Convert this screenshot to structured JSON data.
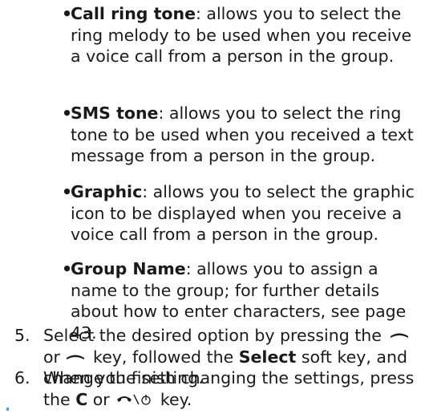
{
  "bullets": [
    {
      "term": "Call ring tone",
      "text": ": allows you to select the ring melody to be used when you receive a voice call from a person in the group."
    },
    {
      "term": "SMS tone",
      "text": ": allows you to select the ring tone to be used when you received a text message from a person in the group."
    },
    {
      "term": "Graphic",
      "text": ": allows you to select the graphic icon to be displayed when you receive a voice call from a person in the group."
    },
    {
      "term": "Group Name",
      "text": ": allows you to assign a name to the group; for further details about how to enter characters, see page 43."
    }
  ],
  "bullet_mark": "•",
  "steps": [
    {
      "number": "5.",
      "part1": "Select the desired option by pressing the",
      "part2": "or",
      "part3": "key, followed the",
      "bold": "Select",
      "part4": "soft key, and change the setting.",
      "icons": [
        "softkey-up-icon",
        "softkey-down-icon"
      ]
    },
    {
      "number": "6.",
      "part1": "When you finish changing the settings, press the",
      "bold": "C",
      "part2": "or",
      "part3": "key.",
      "icons": [
        "end-power-key-icon"
      ]
    }
  ],
  "colors": {
    "text": "#1a1a1a",
    "corner_mark": "#4aa3d8"
  }
}
